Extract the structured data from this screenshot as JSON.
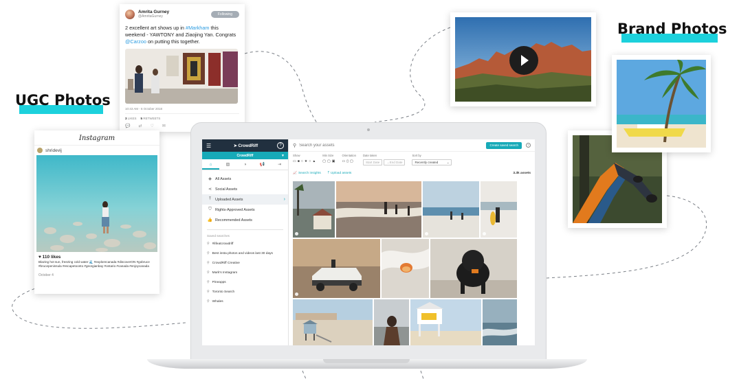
{
  "labels": {
    "ugc": "UGC Photos",
    "brand": "Brand Photos"
  },
  "tweet": {
    "name": "Amrita Gurney",
    "handle": "@AmritaGurney",
    "follow_label": "Following",
    "text_part1": "2 excellent art shows up in ",
    "hashtag": "#Markham",
    "text_part2": " this weekend - YAWTONY and Ziaojing Yan. Congrats ",
    "mention": "@Carzoo",
    "text_part3": " on putting this together.",
    "timestamp": "10:43 AM - 6 October 2018",
    "likes_count": "3",
    "likes_label": "LIKES",
    "retweets_count": "5",
    "retweets_label": "RETWEETS"
  },
  "instagram": {
    "logo": "Instagram",
    "username": "shridevij",
    "likes": "110 likes",
    "caption": "Blazing hot sun, freezing cold water 🌊 #explorecanada #discoverON #gobruce #brucepeninsula #escapetoonto #georgianbay #ontario #canada #enjoycanada",
    "date": "October 4"
  },
  "app": {
    "brand": "CrowdRiff",
    "account": "CrowdRiff",
    "tabs": [
      {
        "icon": "home-icon",
        "glyph": "⌂"
      },
      {
        "icon": "gallery-icon",
        "glyph": "▨"
      },
      {
        "icon": "globe-icon",
        "glyph": "◑"
      },
      {
        "icon": "megaphone-icon",
        "glyph": "📢"
      },
      {
        "icon": "export-icon",
        "glyph": "⇥"
      }
    ],
    "nav": [
      {
        "label": "All Assets",
        "icon": "layers-icon",
        "glyph": "◈"
      },
      {
        "label": "Social Assets",
        "icon": "share-icon",
        "glyph": "⋖"
      },
      {
        "label": "Uploaded Assets",
        "icon": "upload-icon",
        "glyph": "⤒"
      },
      {
        "label": "Rights-Approved Assets",
        "icon": "shield-icon",
        "glyph": "⛉"
      },
      {
        "label": "Recommended Assets",
        "icon": "thumbs-up-icon",
        "glyph": "👍"
      }
    ],
    "saved_title": "Saved searches",
    "saved": [
      "#lifeatcrowdriff",
      "Best insta photos and videos last 30 days",
      "CrowdRiff Creative",
      "Mark's Instagram",
      "Pineapps",
      "Toronto Search",
      "Whales"
    ],
    "search_placeholder": "Search your assets",
    "create_saved_search": "Create saved search",
    "filters": {
      "show_label": "Show",
      "min_size_label": "Min Size",
      "orientation_label": "Orientation",
      "date_taken_label": "Date taken",
      "start_date": "Start Date",
      "end_date": "End Date",
      "sort_label": "Sort by",
      "sort_value": "Recently created"
    },
    "search_insights": "Search insights",
    "upload_assets": "Upload assets",
    "asset_count": "3.3k assets"
  }
}
